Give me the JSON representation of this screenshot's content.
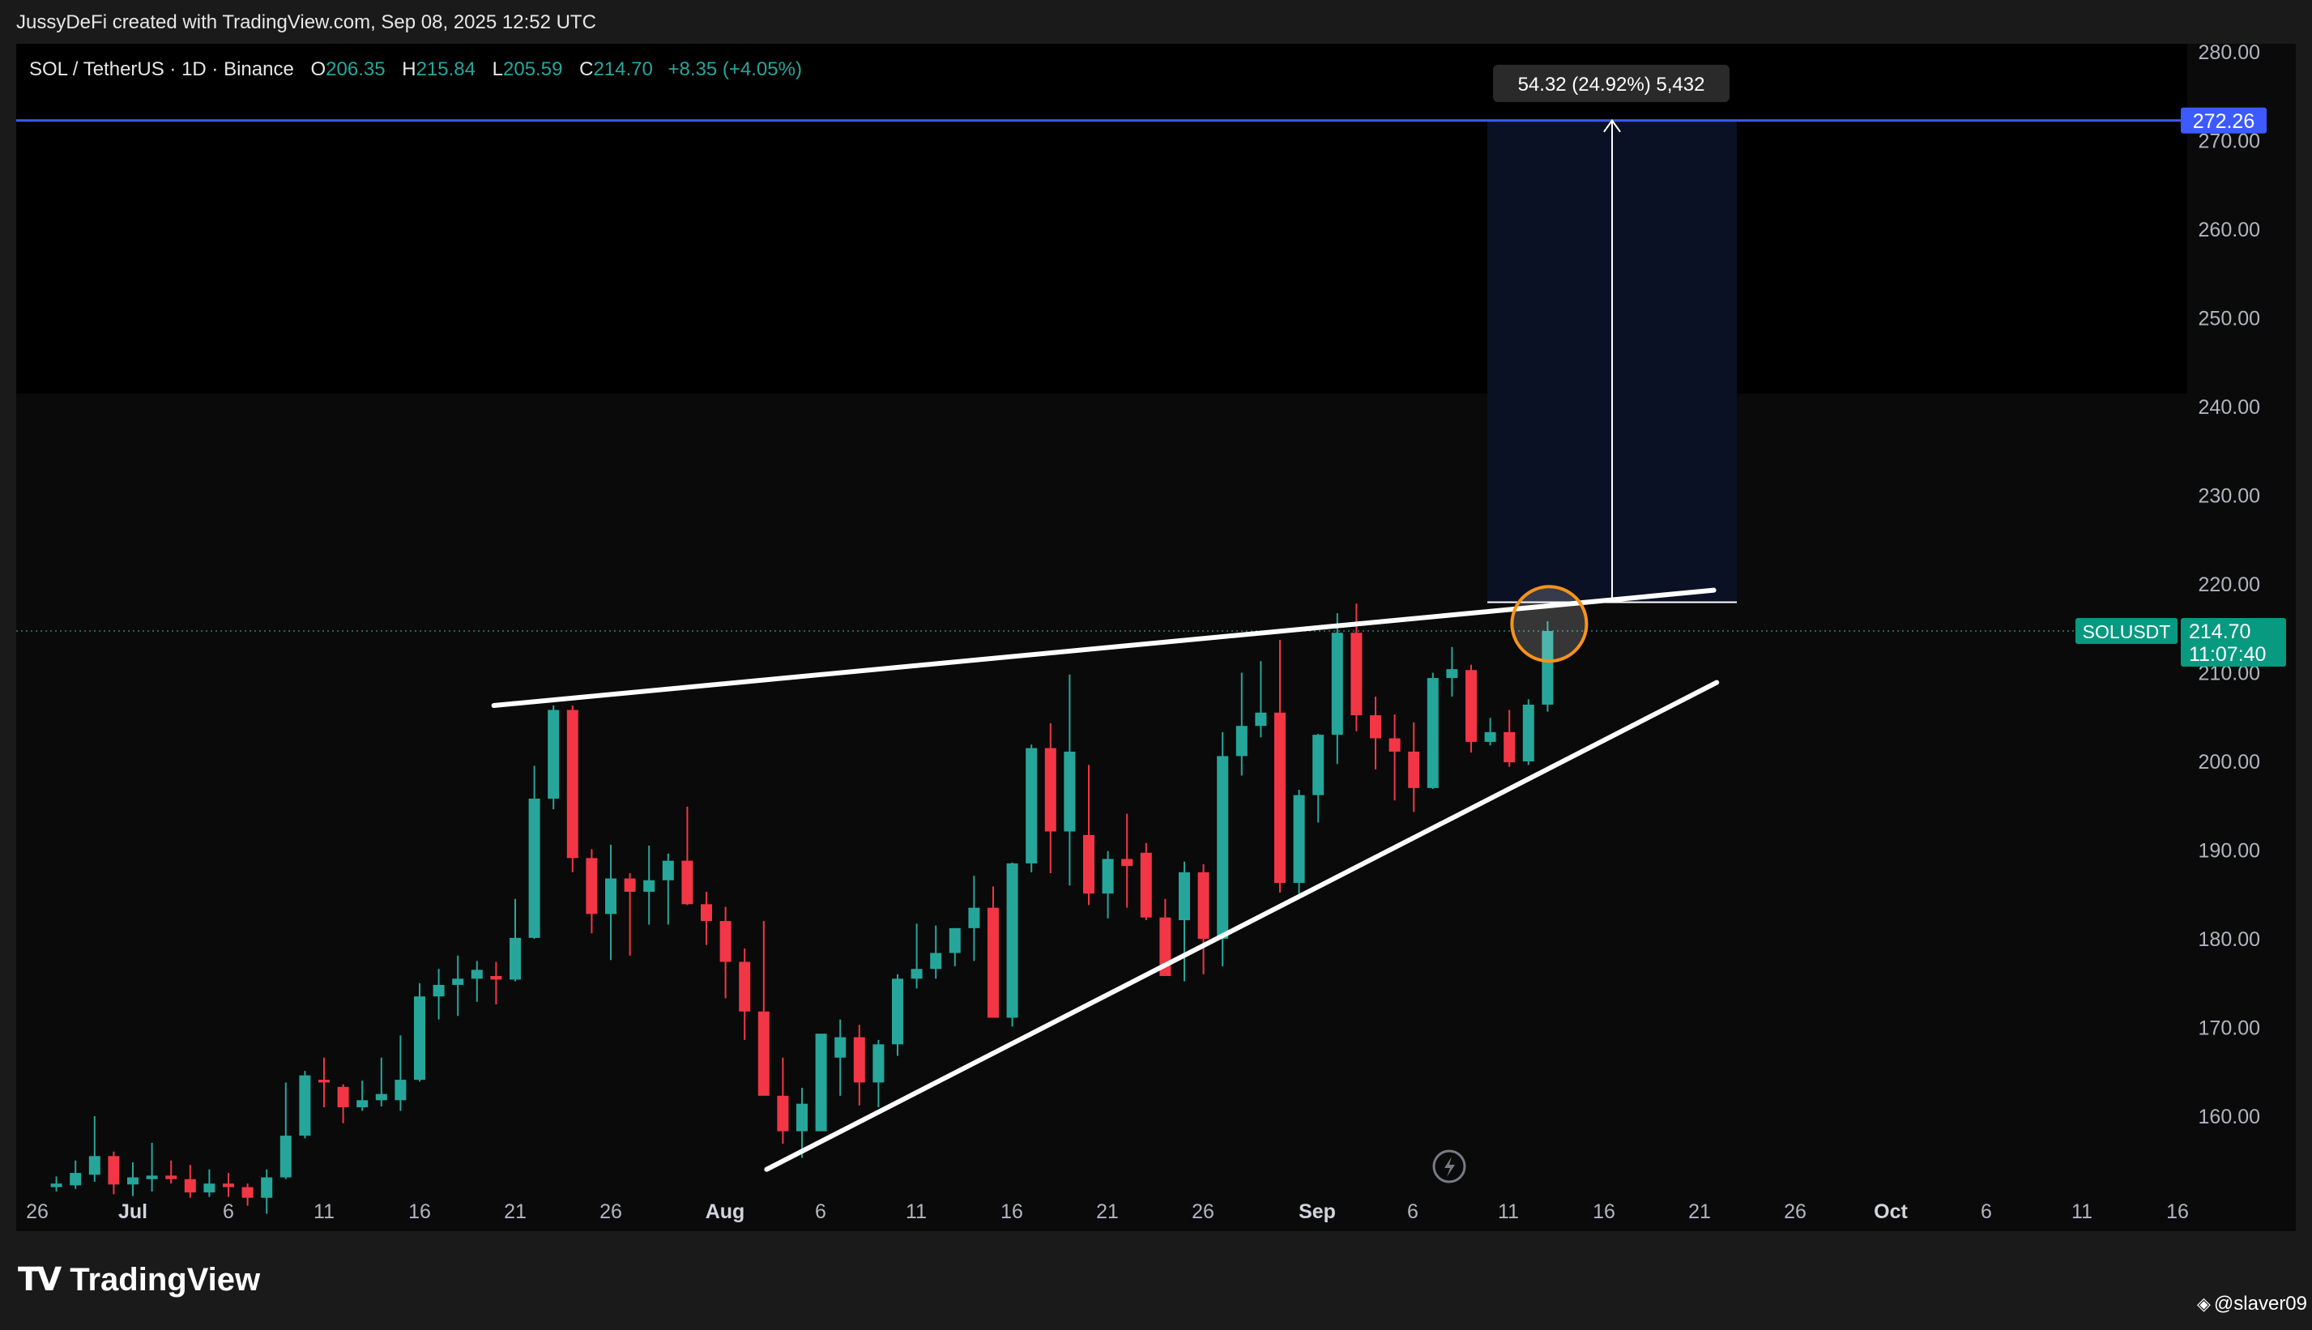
{
  "attribution": "JussyDeFi created with TradingView.com, Sep 08, 2025 12:52 UTC",
  "header": {
    "symbol": "SOL / TetherUS · 1D · Binance",
    "o_label": "O",
    "o_value": "206.35",
    "h_label": "H",
    "h_value": "215.84",
    "l_label": "L",
    "l_value": "205.59",
    "c_label": "C",
    "c_value": "214.70",
    "change": "+8.35 (+4.05%)"
  },
  "measure_label": "54.32 (24.92%) 5,432",
  "price_tags": {
    "target": "272.26",
    "symbol": "SOLUSDT",
    "last": "214.70",
    "countdown": "11:07:40"
  },
  "logo": "TradingView",
  "watermark": "@slaver09",
  "colors": {
    "up": "#26a69a",
    "down": "#f23645",
    "target_line": "#3d5afe",
    "highlight_circle": "#f7931a",
    "trendline": "#ffffff",
    "background": "#0a0a0a"
  },
  "chart_data": {
    "type": "candlestick",
    "title": "SOL / TetherUS · 1D · Binance",
    "ylim": [
      152,
      283
    ],
    "yticks": [
      "280.00",
      "270.00",
      "260.00",
      "250.00",
      "240.00",
      "230.00",
      "220.00",
      "210.00",
      "200.00",
      "190.00",
      "180.00",
      "170.00",
      "160.00"
    ],
    "xticks": [
      "26",
      "Jul",
      "6",
      "11",
      "16",
      "21",
      "26",
      "Aug",
      "6",
      "11",
      "16",
      "21",
      "26",
      "Sep",
      "6",
      "11",
      "16",
      "21",
      "26",
      "Oct",
      "6",
      "11",
      "16"
    ],
    "candles": [
      {
        "date": "2025-06-27",
        "o": 152.0,
        "h": 153.2,
        "l": 151.5,
        "c": 152.4
      },
      {
        "date": "2025-06-28",
        "o": 152.2,
        "h": 155.0,
        "l": 151.8,
        "c": 153.6
      },
      {
        "date": "2025-06-29",
        "o": 153.4,
        "h": 160.0,
        "l": 152.6,
        "c": 155.5
      },
      {
        "date": "2025-06-30",
        "o": 155.5,
        "h": 156.0,
        "l": 151.2,
        "c": 152.3
      },
      {
        "date": "2025-07-01",
        "o": 152.3,
        "h": 154.8,
        "l": 151.0,
        "c": 153.1
      },
      {
        "date": "2025-07-02",
        "o": 152.9,
        "h": 157.0,
        "l": 151.5,
        "c": 153.3
      },
      {
        "date": "2025-07-03",
        "o": 153.3,
        "h": 155.0,
        "l": 152.4,
        "c": 152.9
      },
      {
        "date": "2025-07-04",
        "o": 152.9,
        "h": 154.5,
        "l": 150.8,
        "c": 151.4
      },
      {
        "date": "2025-07-05",
        "o": 151.4,
        "h": 154.0,
        "l": 150.9,
        "c": 152.4
      },
      {
        "date": "2025-07-06",
        "o": 152.4,
        "h": 153.6,
        "l": 150.9,
        "c": 152.0
      },
      {
        "date": "2025-07-07",
        "o": 152.0,
        "h": 152.4,
        "l": 149.9,
        "c": 150.8
      },
      {
        "date": "2025-07-08",
        "o": 150.8,
        "h": 154.0,
        "l": 149.0,
        "c": 153.1
      },
      {
        "date": "2025-07-09",
        "o": 153.1,
        "h": 163.8,
        "l": 152.9,
        "c": 157.8
      },
      {
        "date": "2025-07-10",
        "o": 157.8,
        "h": 165.1,
        "l": 157.5,
        "c": 164.6
      },
      {
        "date": "2025-07-11",
        "o": 164.1,
        "h": 166.6,
        "l": 161.0,
        "c": 163.8
      },
      {
        "date": "2025-07-12",
        "o": 163.3,
        "h": 163.6,
        "l": 159.2,
        "c": 161.0
      },
      {
        "date": "2025-07-13",
        "o": 161.0,
        "h": 164.0,
        "l": 160.6,
        "c": 161.8
      },
      {
        "date": "2025-07-14",
        "o": 161.8,
        "h": 166.6,
        "l": 161.1,
        "c": 162.5
      },
      {
        "date": "2025-07-15",
        "o": 161.8,
        "h": 169.1,
        "l": 160.6,
        "c": 164.1
      },
      {
        "date": "2025-07-16",
        "o": 164.1,
        "h": 175.0,
        "l": 163.9,
        "c": 173.5
      },
      {
        "date": "2025-07-17",
        "o": 173.5,
        "h": 176.6,
        "l": 170.9,
        "c": 174.8
      },
      {
        "date": "2025-07-18",
        "o": 174.8,
        "h": 178.1,
        "l": 171.3,
        "c": 175.5
      },
      {
        "date": "2025-07-19",
        "o": 175.5,
        "h": 177.5,
        "l": 172.9,
        "c": 176.5
      },
      {
        "date": "2025-07-20",
        "o": 175.8,
        "h": 177.4,
        "l": 172.6,
        "c": 175.4
      },
      {
        "date": "2025-07-21",
        "o": 175.4,
        "h": 184.5,
        "l": 175.2,
        "c": 180.1
      },
      {
        "date": "2025-07-22",
        "o": 180.1,
        "h": 199.5,
        "l": 180.0,
        "c": 195.8
      },
      {
        "date": "2025-07-23",
        "o": 195.8,
        "h": 206.3,
        "l": 194.6,
        "c": 205.8
      },
      {
        "date": "2025-07-24",
        "o": 205.8,
        "h": 206.3,
        "l": 187.5,
        "c": 189.1
      },
      {
        "date": "2025-07-25",
        "o": 189.1,
        "h": 190.1,
        "l": 180.6,
        "c": 182.8
      },
      {
        "date": "2025-07-26",
        "o": 182.8,
        "h": 190.6,
        "l": 177.6,
        "c": 186.8
      },
      {
        "date": "2025-07-27",
        "o": 186.8,
        "h": 187.4,
        "l": 178.1,
        "c": 185.3
      },
      {
        "date": "2025-07-28",
        "o": 185.3,
        "h": 190.5,
        "l": 181.6,
        "c": 186.6
      },
      {
        "date": "2025-07-29",
        "o": 186.6,
        "h": 189.6,
        "l": 181.6,
        "c": 188.8
      },
      {
        "date": "2025-07-30",
        "o": 188.8,
        "h": 194.9,
        "l": 183.8,
        "c": 183.9
      },
      {
        "date": "2025-07-31",
        "o": 183.9,
        "h": 185.3,
        "l": 179.3,
        "c": 182.0
      },
      {
        "date": "2025-08-01",
        "o": 182.0,
        "h": 183.6,
        "l": 173.3,
        "c": 177.4
      },
      {
        "date": "2025-08-02",
        "o": 177.4,
        "h": 178.9,
        "l": 168.6,
        "c": 171.8
      },
      {
        "date": "2025-08-03",
        "o": 171.8,
        "h": 182.0,
        "l": 166.6,
        "c": 162.3
      },
      {
        "date": "2025-08-04",
        "o": 162.3,
        "h": 166.6,
        "l": 156.9,
        "c": 158.3
      },
      {
        "date": "2025-08-05",
        "o": 158.3,
        "h": 163.2,
        "l": 155.3,
        "c": 161.4
      },
      {
        "date": "2025-08-06",
        "o": 158.3,
        "h": 166.7,
        "l": 161.2,
        "c": 169.3
      },
      {
        "date": "2025-08-07",
        "o": 166.6,
        "h": 170.9,
        "l": 162.3,
        "c": 168.9
      },
      {
        "date": "2025-08-08",
        "o": 168.9,
        "h": 170.3,
        "l": 161.2,
        "c": 163.8
      },
      {
        "date": "2025-08-09",
        "o": 163.8,
        "h": 168.6,
        "l": 161.0,
        "c": 168.1
      },
      {
        "date": "2025-08-10",
        "o": 168.1,
        "h": 176.0,
        "l": 166.8,
        "c": 175.5
      },
      {
        "date": "2025-08-11",
        "o": 175.5,
        "h": 181.7,
        "l": 174.4,
        "c": 176.6
      },
      {
        "date": "2025-08-12",
        "o": 176.6,
        "h": 181.5,
        "l": 175.5,
        "c": 178.4
      },
      {
        "date": "2025-08-13",
        "o": 178.4,
        "h": 181.2,
        "l": 176.9,
        "c": 181.2
      },
      {
        "date": "2025-08-14",
        "o": 181.2,
        "h": 187.1,
        "l": 177.5,
        "c": 183.5
      },
      {
        "date": "2025-08-15",
        "o": 183.5,
        "h": 185.9,
        "l": 174.1,
        "c": 171.1
      },
      {
        "date": "2025-08-16",
        "o": 171.1,
        "h": 188.6,
        "l": 170.1,
        "c": 188.5
      },
      {
        "date": "2025-08-17",
        "o": 188.5,
        "h": 201.9,
        "l": 187.5,
        "c": 201.5
      },
      {
        "date": "2025-08-18",
        "o": 201.5,
        "h": 204.3,
        "l": 187.4,
        "c": 192.1
      },
      {
        "date": "2025-08-19",
        "o": 192.1,
        "h": 209.8,
        "l": 186.0,
        "c": 201.1
      },
      {
        "date": "2025-08-20",
        "o": 191.7,
        "h": 199.6,
        "l": 183.8,
        "c": 185.1
      },
      {
        "date": "2025-08-21",
        "o": 185.1,
        "h": 189.9,
        "l": 182.3,
        "c": 189.0
      },
      {
        "date": "2025-08-22",
        "o": 189.0,
        "h": 194.1,
        "l": 183.5,
        "c": 188.2
      },
      {
        "date": "2025-08-23",
        "o": 189.7,
        "h": 190.8,
        "l": 182.1,
        "c": 182.4
      },
      {
        "date": "2025-08-24",
        "o": 182.4,
        "h": 184.5,
        "l": 175.9,
        "c": 175.8
      },
      {
        "date": "2025-08-25",
        "o": 182.1,
        "h": 188.7,
        "l": 175.2,
        "c": 187.5
      },
      {
        "date": "2025-08-26",
        "o": 187.5,
        "h": 188.4,
        "l": 176.0,
        "c": 180.0
      },
      {
        "date": "2025-08-27",
        "o": 180.0,
        "h": 203.3,
        "l": 176.9,
        "c": 200.6
      },
      {
        "date": "2025-08-28",
        "o": 200.6,
        "h": 210.0,
        "l": 198.4,
        "c": 204.0
      },
      {
        "date": "2025-08-29",
        "o": 204.0,
        "h": 211.3,
        "l": 202.7,
        "c": 205.5
      },
      {
        "date": "2025-08-30",
        "o": 205.5,
        "h": 213.7,
        "l": 185.2,
        "c": 186.3
      },
      {
        "date": "2025-08-31",
        "o": 186.3,
        "h": 196.8,
        "l": 185.0,
        "c": 196.2
      },
      {
        "date": "2025-09-01",
        "o": 196.2,
        "h": 203.1,
        "l": 193.1,
        "c": 203.0
      },
      {
        "date": "2025-09-02",
        "o": 203.0,
        "h": 216.7,
        "l": 199.7,
        "c": 214.5
      },
      {
        "date": "2025-09-03",
        "o": 214.5,
        "h": 217.8,
        "l": 203.4,
        "c": 205.2
      },
      {
        "date": "2025-09-04",
        "o": 205.2,
        "h": 207.3,
        "l": 199.1,
        "c": 202.6
      },
      {
        "date": "2025-09-05",
        "o": 202.6,
        "h": 205.3,
        "l": 195.6,
        "c": 201.1
      },
      {
        "date": "2025-09-06",
        "o": 201.1,
        "h": 204.4,
        "l": 194.3,
        "c": 197.0
      },
      {
        "date": "2025-09-07",
        "o": 197.0,
        "h": 210.0,
        "l": 196.9,
        "c": 209.4
      },
      {
        "date": "2025-09-08",
        "o": 209.4,
        "h": 212.9,
        "l": 207.3,
        "c": 210.4
      },
      {
        "date": "2025-09-09",
        "o": 210.3,
        "h": 210.9,
        "l": 201.0,
        "c": 202.2
      },
      {
        "date": "2025-09-10",
        "o": 202.2,
        "h": 204.9,
        "l": 201.8,
        "c": 203.3
      },
      {
        "date": "2025-09-11",
        "o": 203.3,
        "h": 205.8,
        "l": 199.4,
        "c": 199.9
      },
      {
        "date": "2025-09-12",
        "o": 200.0,
        "h": 207.0,
        "l": 199.6,
        "c": 206.4
      },
      {
        "date": "2025-09-13",
        "o": 206.4,
        "h": 215.8,
        "l": 205.6,
        "c": 214.7
      }
    ],
    "annotations": {
      "upper_trendline": [
        {
          "date": "2025-07-22",
          "price": 206.3
        },
        {
          "date": "2025-09-20",
          "price": 219.3
        }
      ],
      "lower_trendline": [
        {
          "date": "2025-08-04",
          "price": 154.0
        },
        {
          "date": "2025-09-21",
          "price": 208.9
        }
      ],
      "target_line": 272.26,
      "last_price_line": 214.7,
      "measure": {
        "from_price": 217.94,
        "to_price": 272.26,
        "label": "54.32 (24.92%) 5,432"
      },
      "breakout_circle": {
        "date": "2025-09-13",
        "price": 216.6
      }
    }
  }
}
